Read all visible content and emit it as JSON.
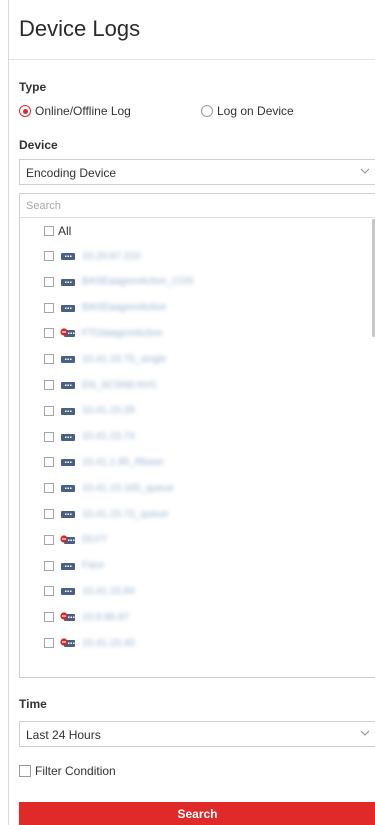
{
  "header": {
    "title": "Device Logs"
  },
  "type_section": {
    "label": "Type",
    "options": [
      {
        "label": "Online/Offline Log",
        "selected": true
      },
      {
        "label": "Log on Device",
        "selected": false
      }
    ]
  },
  "device_section": {
    "label": "Device",
    "selected_value": "Encoding Device",
    "search_placeholder": "Search",
    "all_label": "All",
    "devices": [
      {
        "name": "10.20.87.210",
        "status": "online"
      },
      {
        "name": "BASEaagemActive_COS",
        "status": "online"
      },
      {
        "name": "BASEaagemActive",
        "status": "online"
      },
      {
        "name": "FTOtaagemActive",
        "status": "offline"
      },
      {
        "name": "10.41.15.75_single",
        "status": "online"
      },
      {
        "name": "EN_6CSN8.NVC",
        "status": "online"
      },
      {
        "name": "10.41.15.28",
        "status": "online"
      },
      {
        "name": "10.41.15.74",
        "status": "online"
      },
      {
        "name": "10.41.1.85_Rbase",
        "status": "online"
      },
      {
        "name": "10.41.15.165_queue",
        "status": "online"
      },
      {
        "name": "10.41.15.72_queue",
        "status": "online"
      },
      {
        "name": "DLVY",
        "status": "offline"
      },
      {
        "name": "Face",
        "status": "online"
      },
      {
        "name": "10.41.15.84",
        "status": "online"
      },
      {
        "name": "10.8.86.87",
        "status": "offline"
      },
      {
        "name": "10.41.15.40",
        "status": "offline"
      }
    ]
  },
  "time_section": {
    "label": "Time",
    "selected_value": "Last 24 Hours"
  },
  "filter": {
    "label": "Filter Condition"
  },
  "actions": {
    "search_label": "Search"
  },
  "colors": {
    "accent": "#e02a2a",
    "device_icon": "#4a5f86",
    "offline_badge": "#d62828"
  }
}
